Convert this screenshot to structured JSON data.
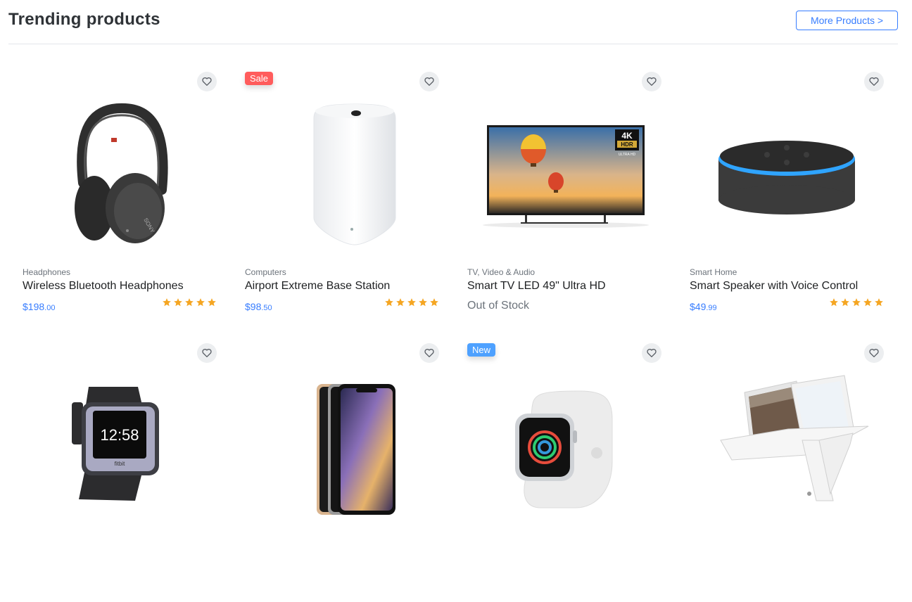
{
  "header": {
    "title": "Trending products",
    "more_label": "More Products >"
  },
  "colors": {
    "accent": "#377dff",
    "sale": "#ff4d4d",
    "new": "#4aa3ff",
    "star": "#f5a623"
  },
  "products": [
    {
      "category": "Headphones",
      "name": "Wireless Bluetooth Headphones",
      "price_main": "$198",
      "price_cents": ".00",
      "rating": 5,
      "badge": "",
      "image": "headphones"
    },
    {
      "category": "Computers",
      "name": "Airport Extreme Base Station",
      "price_main": "$98",
      "price_cents": ".50",
      "rating": 5,
      "badge": "Sale",
      "image": "router"
    },
    {
      "category": "TV, Video & Audio",
      "name": "Smart TV LED 49\" Ultra HD",
      "stock_text": "Out of Stock",
      "rating": 0,
      "badge": "",
      "image": "tv",
      "tv_logo_top": "4K",
      "tv_logo_bottom": "HDR",
      "tv_logo_sub": "ULTRA HD"
    },
    {
      "category": "Smart Home",
      "name": "Smart Speaker with Voice Control",
      "price_main": "$49",
      "price_cents": ".99",
      "rating": 5,
      "badge": "",
      "image": "speaker"
    },
    {
      "image": "fitbit",
      "badge": "",
      "watch_time": "12:58",
      "watch_brand": "fitbit"
    },
    {
      "image": "phone",
      "badge": ""
    },
    {
      "image": "applewatch",
      "badge": "New"
    },
    {
      "image": "laptop",
      "badge": ""
    }
  ]
}
